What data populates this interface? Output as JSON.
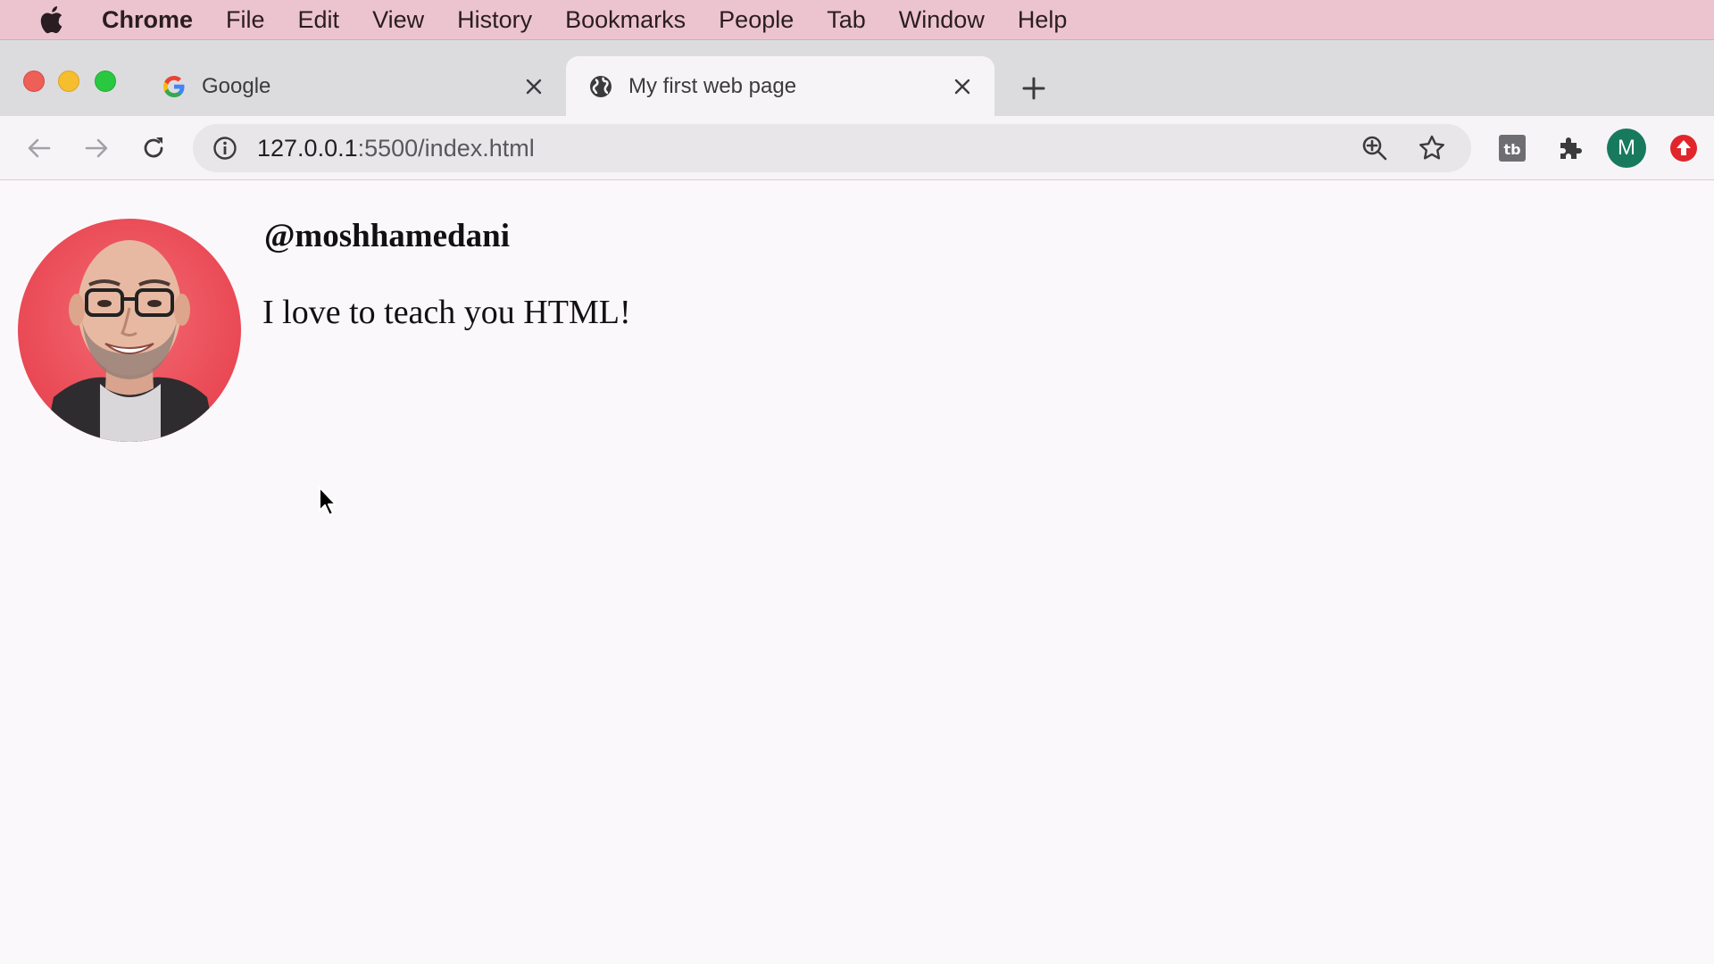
{
  "menubar": {
    "items": [
      "Chrome",
      "File",
      "Edit",
      "View",
      "History",
      "Bookmarks",
      "People",
      "Tab",
      "Window",
      "Help"
    ],
    "background": "#ecc4cf"
  },
  "tabs": [
    {
      "title": "Google",
      "icon": "google-g-icon",
      "active": false
    },
    {
      "title": "My first web page",
      "icon": "globe-icon",
      "active": true
    }
  ],
  "toolbar": {
    "url_host": "127.0.0.1",
    "url_rest": ":5500/index.html",
    "avatar_letter": "M",
    "avatar_color": "#177a5c"
  },
  "page": {
    "username": "@moshhamedani",
    "bio": "I love to teach you HTML!"
  }
}
